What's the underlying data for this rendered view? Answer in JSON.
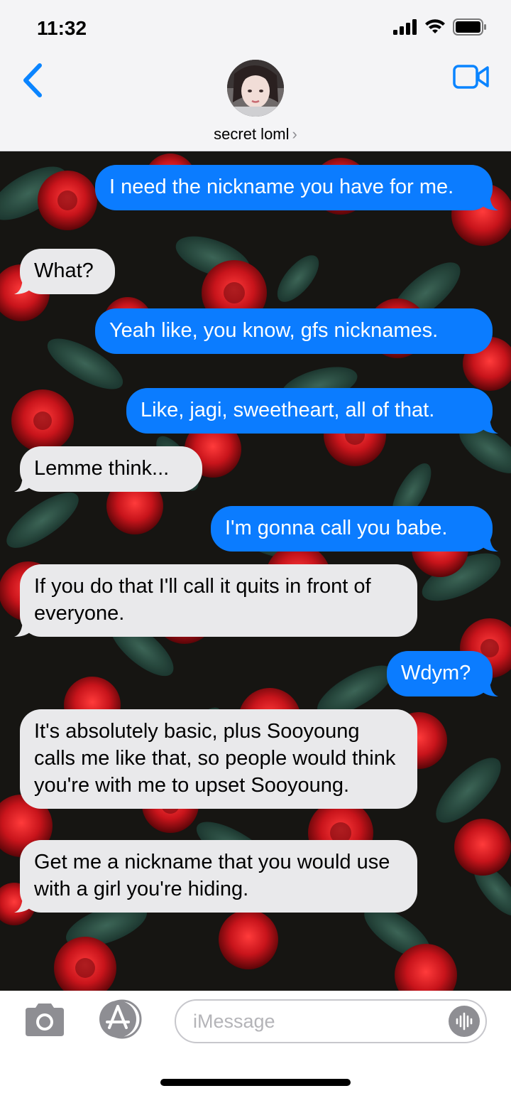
{
  "status_bar": {
    "time": "11:32"
  },
  "header": {
    "contact_name": "secret loml",
    "chevron": "›"
  },
  "messages": [
    {
      "side": "sent",
      "text": "I need the nickname you have for me."
    },
    {
      "side": "recv",
      "text": "What?"
    },
    {
      "side": "sent",
      "text": "Yeah like, you know, gfs nicknames."
    },
    {
      "side": "sent",
      "text": "Like, jagi, sweetheart, all of that."
    },
    {
      "side": "recv",
      "text": "Lemme think..."
    },
    {
      "side": "sent",
      "text": "I'm gonna call you babe."
    },
    {
      "side": "recv",
      "text": "If you do that I'll call it quits in front of everyone."
    },
    {
      "side": "sent",
      "text": "Wdym?"
    },
    {
      "side": "recv",
      "text": "It's absolutely basic, plus Sooyoung calls me like that, so people would think you're with me to upset Sooyoung."
    },
    {
      "side": "recv",
      "text": "Get me a nickname that you would use with a girl you're hiding."
    }
  ],
  "compose": {
    "placeholder": "iMessage"
  },
  "colors": {
    "sent": "#0b7cff",
    "received": "#e9e9eb",
    "accent": "#0a84ff"
  },
  "icons": [
    "back-chevron-icon",
    "video-camera-icon",
    "camera-icon",
    "app-store-icon",
    "audio-waveform-icon",
    "signal-icon",
    "wifi-icon",
    "battery-icon"
  ]
}
